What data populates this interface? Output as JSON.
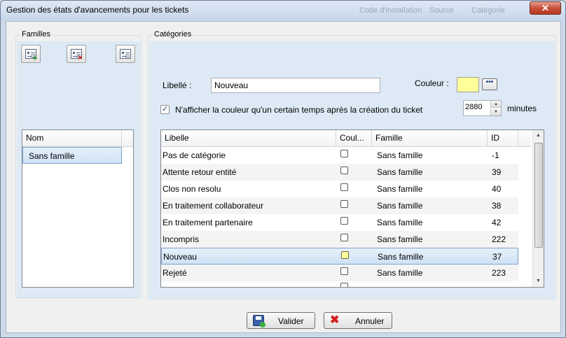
{
  "window": {
    "title": "Gestion des états d'avancements pour les tickets",
    "close_glyph": "✕",
    "ghost": [
      "Code d'installation",
      "Source",
      "Catégorie"
    ]
  },
  "familles": {
    "legend": "Familles",
    "toolbar": {
      "add_icon": "add-family-icon",
      "delete_icon": "delete-family-icon",
      "edit_icon": "edit-family-icon"
    },
    "grid": {
      "header": "Nom",
      "rows": [
        "Sans famille"
      ]
    }
  },
  "categories": {
    "legend": "Catégories",
    "libelle_label": "Libellé :",
    "libelle_value": "Nouveau",
    "couleur_label": "Couleur :",
    "couleur_hex": "#ffff99",
    "dots_button": "•••",
    "checkbox_label": "N'afficher la couleur qu'un certain temps après la création du ticket",
    "checkbox_checked": true,
    "check_glyph": "✓",
    "minutes_value": "2880",
    "minutes_label": "minutes",
    "spin_up": "▲",
    "spin_down": "▼",
    "grid": {
      "headers": [
        "Libelle",
        "Coul...",
        "Famille",
        "ID"
      ],
      "rows": [
        {
          "libelle": "Pas de catégorie",
          "color": false,
          "famille": "Sans famille",
          "id": "-1"
        },
        {
          "libelle": "Attente retour entité",
          "color": false,
          "famille": "Sans famille",
          "id": "39"
        },
        {
          "libelle": "Clos non resolu",
          "color": false,
          "famille": "Sans famille",
          "id": "40"
        },
        {
          "libelle": "En traitement collaborateur",
          "color": false,
          "famille": "Sans famille",
          "id": "38"
        },
        {
          "libelle": "En traitement partenaire",
          "color": false,
          "famille": "Sans famille",
          "id": "42"
        },
        {
          "libelle": "Incompris",
          "color": false,
          "famille": "Sans famille",
          "id": "222"
        },
        {
          "libelle": "Nouveau",
          "color": true,
          "famille": "Sans famille",
          "id": "37",
          "selected": true
        },
        {
          "libelle": "Rejeté",
          "color": false,
          "famille": "Sans famille",
          "id": "223"
        }
      ],
      "scroll_up": "▲",
      "scroll_down": "▼"
    }
  },
  "footer": {
    "valider_label": "Valider",
    "annuler_label": "Annuler",
    "annuler_glyph": "✖"
  }
}
